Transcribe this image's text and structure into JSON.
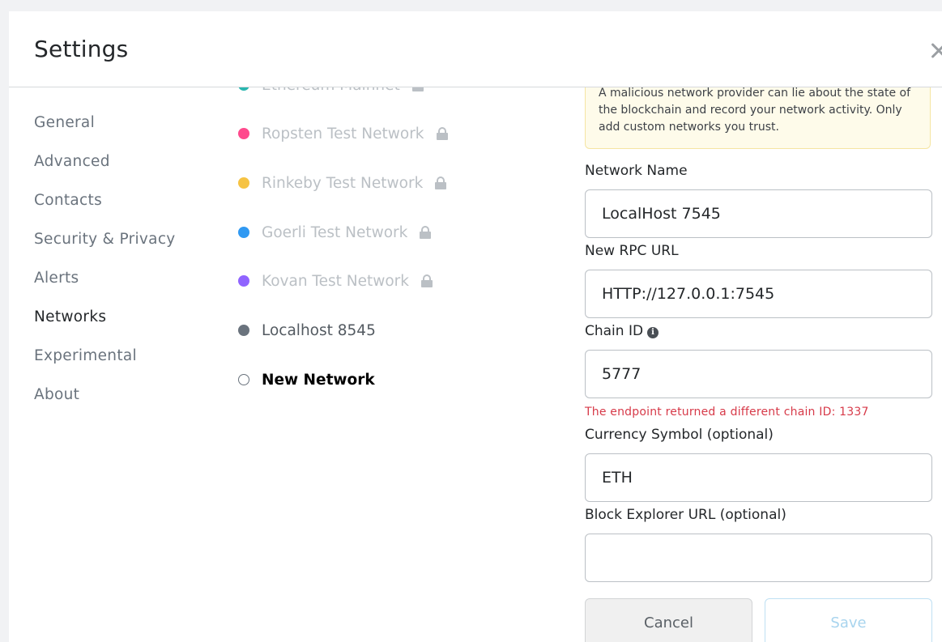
{
  "header": {
    "title": "Settings"
  },
  "sidebar": {
    "items": [
      {
        "label": "General"
      },
      {
        "label": "Advanced"
      },
      {
        "label": "Contacts"
      },
      {
        "label": "Security & Privacy"
      },
      {
        "label": "Alerts"
      },
      {
        "label": "Networks",
        "active": true
      },
      {
        "label": "Experimental"
      },
      {
        "label": "About"
      }
    ]
  },
  "networks": {
    "items": [
      {
        "label": "Ethereum Mainnet",
        "color": "#29b6af",
        "locked": true
      },
      {
        "label": "Ropsten Test Network",
        "color": "#ff4a8d",
        "locked": true
      },
      {
        "label": "Rinkeby Test Network",
        "color": "#f6c343",
        "locked": true
      },
      {
        "label": "Goerli Test Network",
        "color": "#3099f2",
        "locked": true
      },
      {
        "label": "Kovan Test Network",
        "color": "#9064ff",
        "locked": true
      },
      {
        "label": "Localhost 8545",
        "color": "#6a737d",
        "locked": false
      },
      {
        "label": "New Network",
        "color": "#ffffff",
        "locked": false,
        "selected": true
      }
    ]
  },
  "form": {
    "warning": "A malicious network provider can lie about the state of the blockchain and record your network activity. Only add custom networks you trust.",
    "network_name": {
      "label": "Network Name",
      "value": "LocalHost 7545"
    },
    "rpc_url": {
      "label": "New RPC URL",
      "value": "HTTP://127.0.0.1:7545"
    },
    "chain_id": {
      "label": "Chain ID",
      "value": "5777",
      "info_icon": "info-icon"
    },
    "chain_id_error": "The endpoint returned a different chain ID: 1337",
    "currency_symbol": {
      "label": "Currency Symbol (optional)",
      "value": "ETH"
    },
    "block_explorer": {
      "label": "Block Explorer URL (optional)",
      "value": ""
    },
    "cancel_label": "Cancel",
    "save_label": "Save"
  }
}
